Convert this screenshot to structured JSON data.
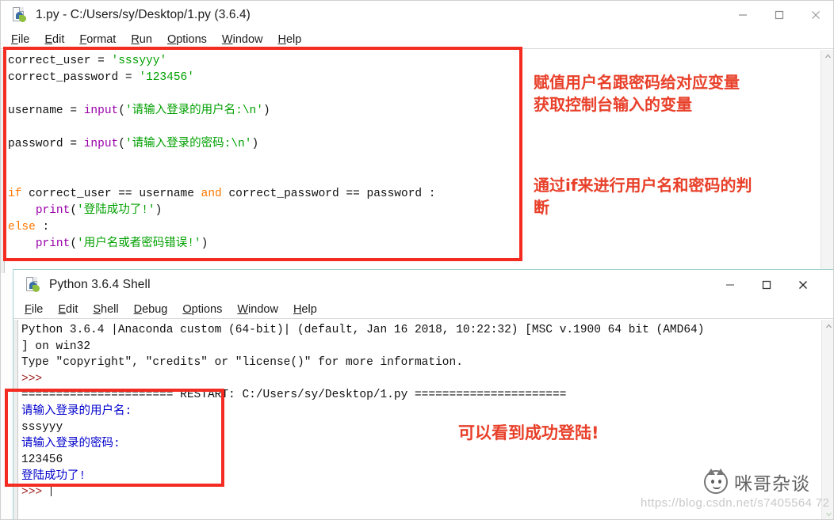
{
  "editor_window": {
    "title": "1.py - C:/Users/sy/Desktop/1.py (3.6.4)",
    "icon": "python-file-icon",
    "controls": {
      "minimize": "minimize-icon",
      "maximize": "maximize-icon",
      "close": "close-icon"
    },
    "menu": [
      "File",
      "Edit",
      "Format",
      "Run",
      "Options",
      "Window",
      "Help"
    ],
    "code_lines": [
      [
        {
          "t": "correct_user = ",
          "c": "def"
        },
        {
          "t": "'sssyyy'",
          "c": "str"
        }
      ],
      [
        {
          "t": "correct_password = ",
          "c": "def"
        },
        {
          "t": "'123456'",
          "c": "str"
        }
      ],
      [
        {
          "t": "",
          "c": "def"
        }
      ],
      [
        {
          "t": "username = ",
          "c": "def"
        },
        {
          "t": "input",
          "c": "bi"
        },
        {
          "t": "(",
          "c": "def"
        },
        {
          "t": "'请输入登录的用户名:\\n'",
          "c": "str"
        },
        {
          "t": ")",
          "c": "def"
        }
      ],
      [
        {
          "t": "",
          "c": "def"
        }
      ],
      [
        {
          "t": "password = ",
          "c": "def"
        },
        {
          "t": "input",
          "c": "bi"
        },
        {
          "t": "(",
          "c": "def"
        },
        {
          "t": "'请输入登录的密码:\\n'",
          "c": "str"
        },
        {
          "t": ")",
          "c": "def"
        }
      ],
      [
        {
          "t": "",
          "c": "def"
        }
      ],
      [
        {
          "t": "",
          "c": "def"
        }
      ],
      [
        {
          "t": "if",
          "c": "kw"
        },
        {
          "t": " correct_user == username ",
          "c": "def"
        },
        {
          "t": "and",
          "c": "kw"
        },
        {
          "t": " correct_password == password :",
          "c": "def"
        }
      ],
      [
        {
          "t": "    ",
          "c": "def"
        },
        {
          "t": "print",
          "c": "bi"
        },
        {
          "t": "(",
          "c": "def"
        },
        {
          "t": "'登陆成功了!'",
          "c": "str"
        },
        {
          "t": ")",
          "c": "def"
        }
      ],
      [
        {
          "t": "else",
          "c": "kw"
        },
        {
          "t": " :",
          "c": "def"
        }
      ],
      [
        {
          "t": "    ",
          "c": "def"
        },
        {
          "t": "print",
          "c": "bi"
        },
        {
          "t": "(",
          "c": "def"
        },
        {
          "t": "'用户名或者密码错误!'",
          "c": "str"
        },
        {
          "t": ")",
          "c": "def"
        }
      ]
    ]
  },
  "shell_window": {
    "title": "Python 3.6.4 Shell",
    "icon": "python-file-icon",
    "controls": {
      "minimize": "minimize-icon",
      "maximize": "maximize-icon",
      "close": "close-icon"
    },
    "menu": [
      "File",
      "Edit",
      "Shell",
      "Debug",
      "Options",
      "Window",
      "Help"
    ],
    "output_lines": [
      [
        {
          "t": "Python 3.6.4 |Anaconda custom (64-bit)| (default, Jan 16 2018, 10:22:32) [MSC v.1900 64 bit (AMD64)",
          "c": "black"
        }
      ],
      [
        {
          "t": "] on win32",
          "c": "black"
        }
      ],
      [
        {
          "t": "Type \"copyright\", \"credits\" or \"license()\" for more information.",
          "c": "black"
        }
      ],
      [
        {
          "t": ">>> ",
          "c": "red"
        }
      ],
      [
        {
          "t": "====================== RESTART: C:/Users/sy/Desktop/1.py ======================",
          "c": "black"
        }
      ],
      [
        {
          "t": "请输入登录的用户名:",
          "c": "blue"
        }
      ],
      [
        {
          "t": "sssyyy",
          "c": "black"
        }
      ],
      [
        {
          "t": "请输入登录的密码:",
          "c": "blue"
        }
      ],
      [
        {
          "t": "123456",
          "c": "black"
        }
      ],
      [
        {
          "t": "登陆成功了!",
          "c": "blue"
        }
      ],
      [
        {
          "t": ">>> ",
          "c": "red"
        },
        {
          "t": "__CARET__",
          "c": "caret"
        }
      ]
    ]
  },
  "annotations": {
    "note_assign": "赋值用户名跟密码给对应变量\n获取控制台输入的变量",
    "note_if": "通过if来进行用户名和密码的判\n断",
    "note_success": "可以看到成功登陆!"
  },
  "watermark": {
    "brand": "咪哥杂谈",
    "icon": "cat-face-icon",
    "url": "https://blog.csdn.net/s7405564 72"
  },
  "colors": {
    "annotation_red": "#E8402A",
    "box_red": "#F42B20",
    "string_green": "#00A000",
    "keyword_orange": "#FF7700",
    "builtin_purple": "#9900AA",
    "shell_blue": "#0000CC",
    "shell_prompt_red": "#A02020"
  }
}
